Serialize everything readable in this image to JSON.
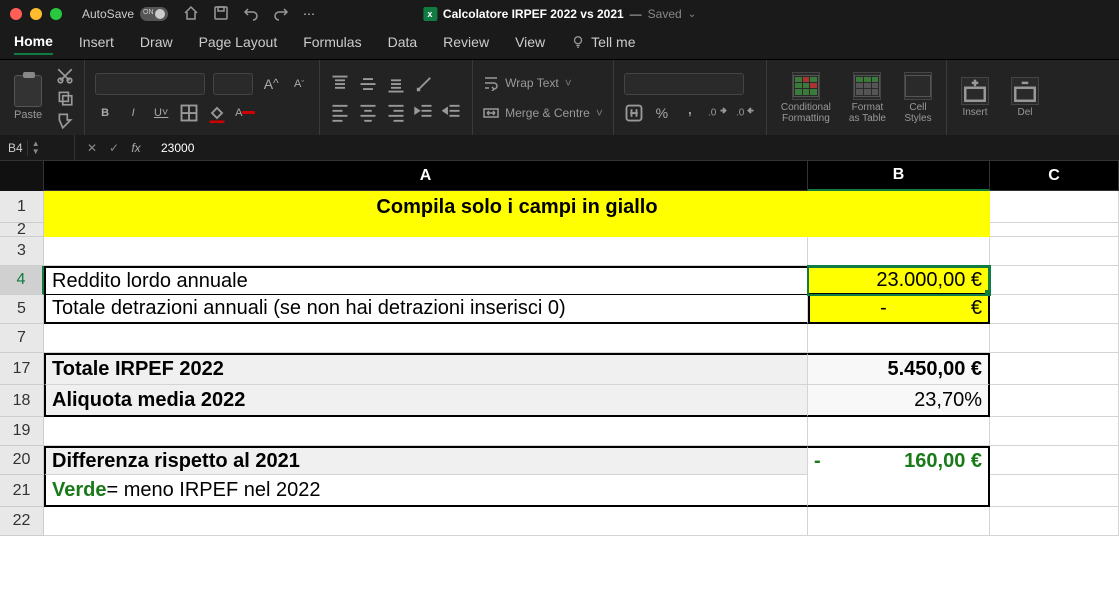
{
  "titlebar": {
    "autosave_label": "AutoSave",
    "toggle_text": "ON",
    "doc_title": "Calcolatore IRPEF 2022 vs 2021",
    "saved_label": "Saved"
  },
  "tabs": {
    "home": "Home",
    "insert": "Insert",
    "draw": "Draw",
    "page_layout": "Page Layout",
    "formulas": "Formulas",
    "data": "Data",
    "review": "Review",
    "view": "View",
    "tell_me": "Tell me"
  },
  "ribbon": {
    "paste": "Paste",
    "wrap": "Wrap Text",
    "merge": "Merge & Centre",
    "cond_fmt": "Conditional\nFormatting",
    "fmt_table": "Format\nas Table",
    "cell_styles": "Cell\nStyles",
    "insert": "Insert",
    "del": "Del",
    "font_aa_up": "A",
    "font_aa_dn": "A",
    "bold": "B",
    "italic": "I",
    "uline": "U",
    "pct": "%"
  },
  "fbar": {
    "name": "B4",
    "fx": "fx",
    "value": "23000"
  },
  "cols": {
    "a": "A",
    "b": "B",
    "c": "C"
  },
  "rows": [
    "1",
    "2",
    "3",
    "4",
    "5",
    "7",
    "17",
    "18",
    "19",
    "20",
    "21",
    "22"
  ],
  "sheet": {
    "banner": "Compila solo i campi in giallo",
    "r4_label": "Reddito lordo annuale",
    "r4_value": "23.000,00 €",
    "r5_label": "Totale detrazioni annuali (se non hai detrazioni inserisci 0)",
    "r5_value_dash": "-",
    "r5_value_eur": "€",
    "r17_label": "Totale IRPEF 2022",
    "r17_value": "5.450,00 €",
    "r18_label": "Aliquota media 2022",
    "r18_value": "23,70%",
    "r20_label": "Differenza rispetto al 2021",
    "r20_sign": "-",
    "r20_value": "160,00 €",
    "r21_verde": "Verde",
    "r21_rest": " = meno IRPEF nel 2022"
  }
}
